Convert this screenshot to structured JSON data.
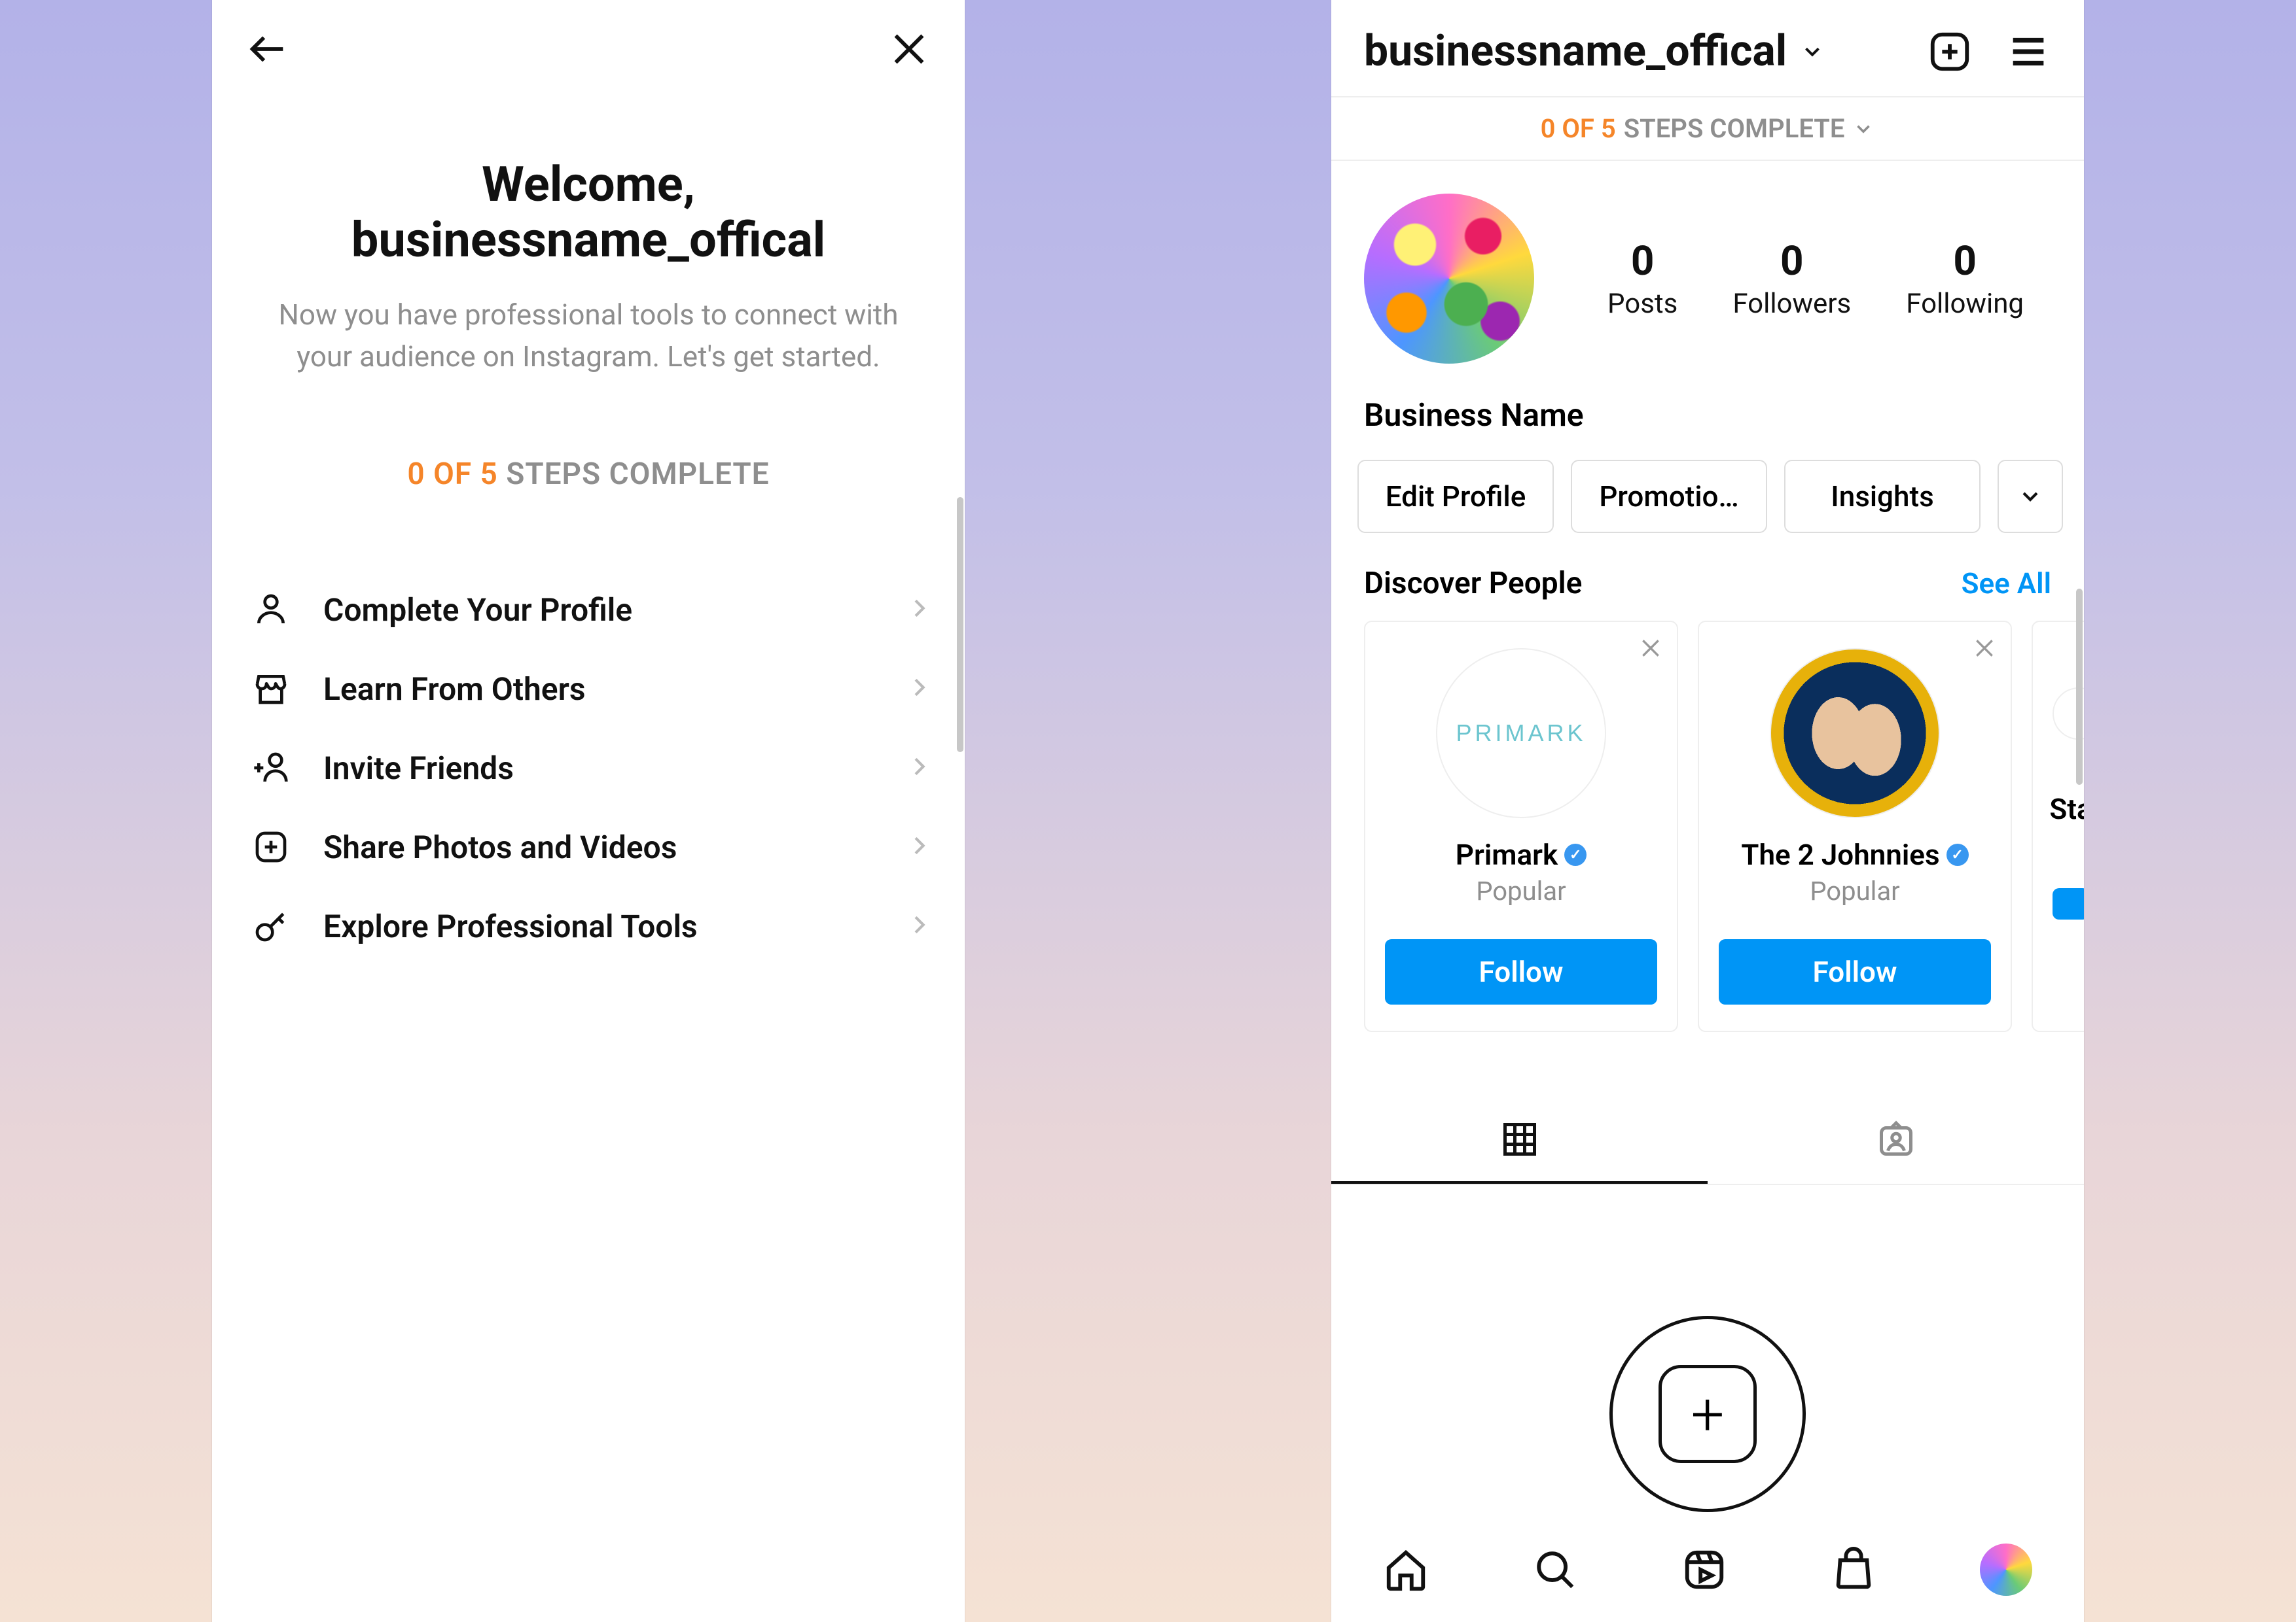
{
  "left": {
    "welcome_line1": "Welcome,",
    "welcome_line2": "businessname_offical",
    "subtitle": "Now you have professional tools to connect with your audience on Instagram. Let's get started.",
    "steps_prefix": "0 OF 5",
    "steps_suffix": " STEPS COMPLETE",
    "items": [
      {
        "label": "Complete Your Profile"
      },
      {
        "label": "Learn From Others"
      },
      {
        "label": "Invite Friends"
      },
      {
        "label": "Share Photos and Videos"
      },
      {
        "label": "Explore Professional Tools"
      }
    ]
  },
  "right": {
    "username": "businessname_offical",
    "bar_prefix": "0 OF 5",
    "bar_suffix": " STEPS COMPLETE",
    "stats": {
      "posts_n": "0",
      "posts_l": "Posts",
      "followers_n": "0",
      "followers_l": "Followers",
      "following_n": "0",
      "following_l": "Following"
    },
    "display_name": "Business Name",
    "buttons": {
      "edit": "Edit Profile",
      "promo": "Promotio…",
      "insights": "Insights"
    },
    "discover": {
      "title": "Discover People",
      "see_all": "See All"
    },
    "cards": [
      {
        "name": "Primark",
        "sub": "Popular",
        "follow": "Follow",
        "avatar_text": "PRIMARK"
      },
      {
        "name": "The 2 Johnnies",
        "sub": "Popular",
        "follow": "Follow"
      },
      {
        "name_partial": "Sta"
      }
    ]
  }
}
